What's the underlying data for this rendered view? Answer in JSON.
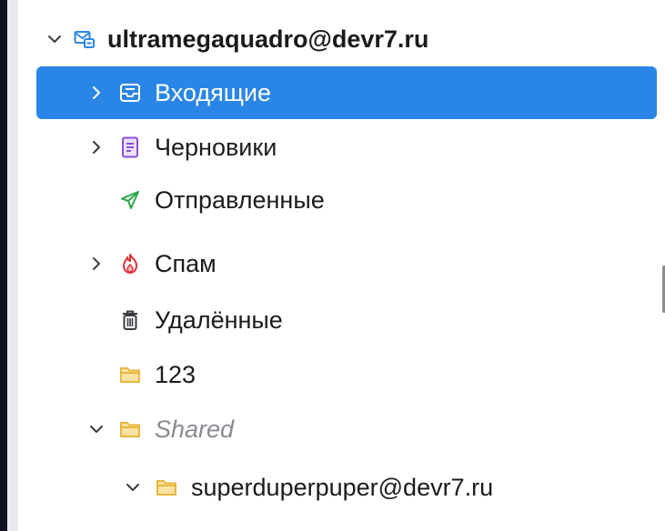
{
  "account": {
    "name": "ultramegaquadro@devr7.ru",
    "icon": "mail-account-icon"
  },
  "folders": [
    {
      "label": "Входящие",
      "icon": "inbox-icon",
      "expandable": true,
      "selected": true
    },
    {
      "label": "Черновики",
      "icon": "drafts-icon",
      "expandable": true,
      "selected": false
    },
    {
      "label": "Отправленные",
      "icon": "sent-icon",
      "expandable": false,
      "selected": false
    },
    {
      "label": "Спам",
      "icon": "spam-icon",
      "expandable": true,
      "selected": false
    },
    {
      "label": "Удалённые",
      "icon": "trash-icon",
      "expandable": false,
      "selected": false
    },
    {
      "label": "123",
      "icon": "folder-icon",
      "expandable": false,
      "selected": false
    },
    {
      "label": "Shared",
      "icon": "folder-icon",
      "expandable": true,
      "expanded": true,
      "selected": false
    },
    {
      "label": "superduperpuper@devr7.ru",
      "icon": "folder-icon",
      "expandable": true,
      "expanded": true,
      "selected": false
    }
  ],
  "colors": {
    "selection": "#2a86e6",
    "account_icon": "#2a86e6",
    "drafts_icon": "#8c4fd9",
    "sent_icon": "#29a94b",
    "spam_icon": "#e0313a",
    "trash_icon": "#3b3b42",
    "folder_icon": "#e9b63d"
  }
}
